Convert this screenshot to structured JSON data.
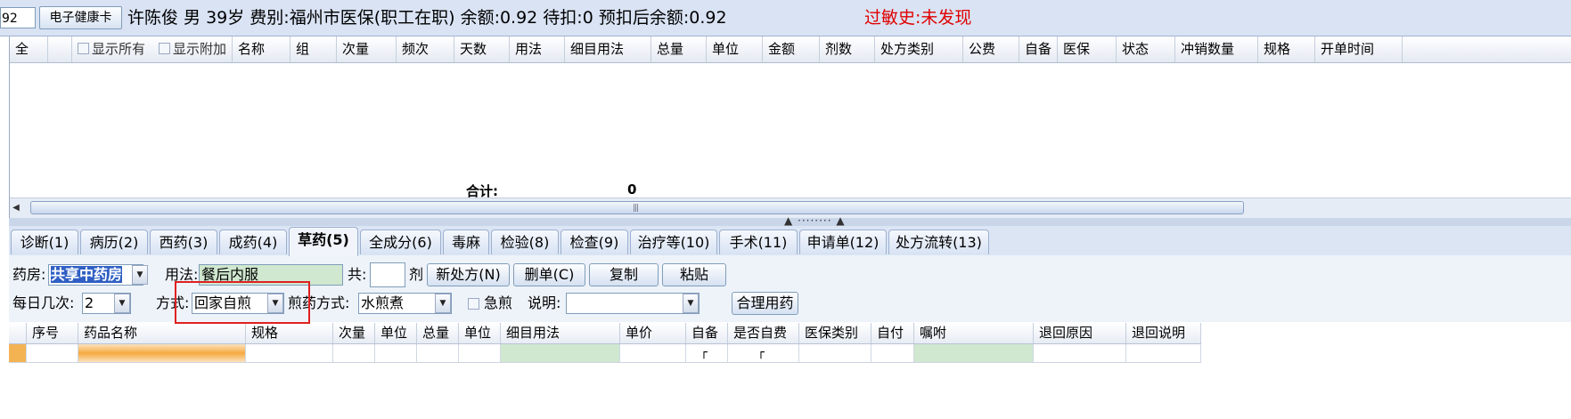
{
  "header": {
    "id_value": "92",
    "health_card_button": "电子健康卡",
    "patient_info": "许陈俊 男 39岁 费别:福州市医保(职工在职) 余额:0.92 待扣:0 预扣后余额:0.92",
    "allergy": "过敏史:未发现"
  },
  "prescription_grid": {
    "select_all": "全",
    "show_all": "显示所有",
    "show_extra": "显示附加",
    "columns": [
      "名称",
      "组",
      "次量",
      "频次",
      "天数",
      "用法",
      "细目用法",
      "总量",
      "单位",
      "金额",
      "剂数",
      "处方类别",
      "公费",
      "自备",
      "医保",
      "状态",
      "冲销数量",
      "规格",
      "开单时间"
    ],
    "total_label": "合计:",
    "total_value": "0"
  },
  "tabs": [
    {
      "label": "诊断(1)"
    },
    {
      "label": "病历(2)"
    },
    {
      "label": "西药(3)"
    },
    {
      "label": "成药(4)"
    },
    {
      "label": "草药(5)",
      "active": true
    },
    {
      "label": "全成分(6)"
    },
    {
      "label": "毒麻"
    },
    {
      "label": "检验(8)"
    },
    {
      "label": "检查(9)"
    },
    {
      "label": "治疗等(10)"
    },
    {
      "label": "手术(11)"
    },
    {
      "label": "申请单(12)"
    },
    {
      "label": "处方流转(13)"
    }
  ],
  "form": {
    "pharmacy_label": "药房:",
    "pharmacy_value": "共享中药房",
    "usage_label": "用法:",
    "usage_value": "餐后内服",
    "total_label": "共:",
    "total_value": "",
    "dose_unit": "剂",
    "new_prescription_button": "新处方(N)",
    "delete_button": "删单(C)",
    "copy_button": "复制",
    "paste_button": "粘贴",
    "daily_times_label": "每日几次:",
    "daily_times_value": "2",
    "method_label": "方式:",
    "method_value": "回家自煎",
    "decoct_method_label": "煎药方式:",
    "decoct_method_value": "水煎煮",
    "urgent_label": "急煎",
    "note_label": "说明:",
    "note_value": "",
    "rational_drug_button": "合理用药"
  },
  "herb_grid": {
    "columns": [
      "序号",
      "药品名称",
      "规格",
      "次量",
      "单位",
      "总量",
      "单位",
      "细目用法",
      "单价",
      "自备",
      "是否自费",
      "医保类别",
      "自付",
      "嘱咐",
      "退回原因",
      "退回说明"
    ]
  },
  "colors": {
    "allergy_text": "#e00000",
    "highlight_box": "#e02020",
    "selected_cell": "#f7a93a",
    "editable_cell": "#cfe8cf"
  }
}
